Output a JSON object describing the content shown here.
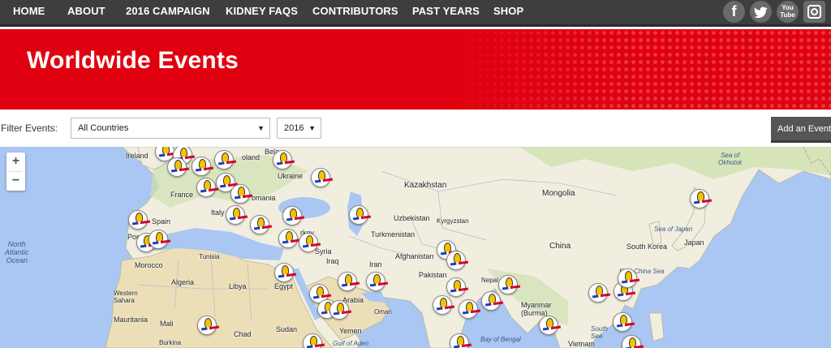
{
  "nav": {
    "items": [
      "HOME",
      "ABOUT",
      "2016 CAMPAIGN",
      "KIDNEY FAQS",
      "CONTRIBUTORS",
      "PAST YEARS",
      "SHOP"
    ],
    "social_icons": [
      "facebook-icon",
      "twitter-icon",
      "youtube-icon",
      "instagram-icon"
    ],
    "youtube_text_top": "You",
    "youtube_text_bottom": "Tube",
    "facebook_glyph": "f"
  },
  "hero": {
    "title": "Worldwide Events"
  },
  "filters": {
    "label": "Filter Events:",
    "country_value": "All Countries",
    "year_value": "2016",
    "add_button": "Add an Event"
  },
  "map": {
    "zoom_in": "+",
    "zoom_out": "−",
    "caret": "▼",
    "labels": {
      "ireland": "Ireland",
      "poland": "oland",
      "belarus": "Bela",
      "ukraine": "Ukraine",
      "france": "France",
      "romania": "omania",
      "italy": "Italy",
      "spain": "Spain",
      "portugal": "Por",
      "turkey": "rkey",
      "syria": "Syria",
      "tunisia": "Tunisia",
      "morocco": "Morocco",
      "algeria": "Algeria",
      "libya": "Libya",
      "egypt": "Egypt",
      "iraq": "Iraq",
      "iran": "Iran",
      "arabia": "Arabia",
      "oman": "Oman",
      "yemen": "Yemen",
      "sudan": "Sudan",
      "chad": "Chad",
      "mali": "Mali",
      "mauritania": "Mauritania",
      "western_sahara": "Western\nSahara",
      "burkina": "Burkina",
      "kazakhstan": "Kazakhstan",
      "uzbekistan": "Uzbekistan",
      "kyrgyzstan": "Kyrgyzstan",
      "turkmenistan": "Turkmenistan",
      "afghanistan": "Afghanistan",
      "pakistan": "Pakistan",
      "nepal": "Nepal",
      "india": "dia",
      "myanmar": "Myanmar\n(Burma)",
      "china": "China",
      "mongolia": "Mongolia",
      "south_korea": "South Korea",
      "japan": "Japan",
      "vietnam": "Vietnam",
      "north_atlantic": "North\nAtlantic\nOcean",
      "sea_of_okhotsk": "Sea of\nOkhotsk",
      "sea_of_japan": "Sea of Japan",
      "east_china_sea": "East China Sea",
      "bay_of_bengal": "Bay of Bengal",
      "south_sea": "South\nSea",
      "gulf_of_aden": "Gulf of Aden"
    }
  },
  "colors": {
    "nav_bg": "#3e3e3e",
    "hero_red": "#e1000f",
    "water": "#a9c7f2",
    "land": "#f1eee0",
    "land_green": "#cfe1b0",
    "desert": "#ecdfb8"
  }
}
